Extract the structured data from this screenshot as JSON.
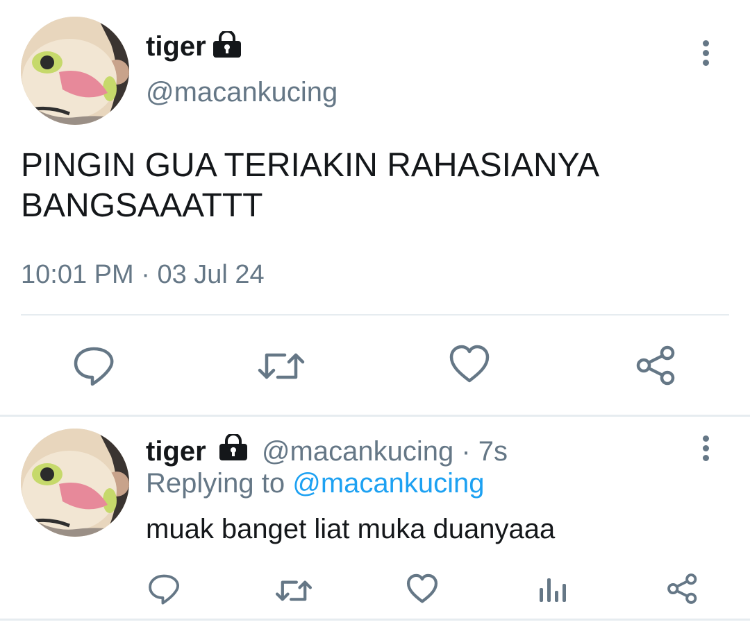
{
  "main_tweet": {
    "display_name": "tiger",
    "handle": "@macankucing",
    "text_line1": "PINGIN GUA TERIAKIN RAHASIANYA",
    "text_line2": "BANGSAAATTT",
    "time": "10:01 PM",
    "separator": "·",
    "date": "03 Jul 24",
    "avatar_icon": "tiger-plush-avatar",
    "locked_icon": "lock-icon",
    "actions": [
      "reply-icon",
      "retweet-icon",
      "like-icon",
      "share-icon"
    ]
  },
  "reply_tweet": {
    "display_name": "tiger",
    "handle": "@macankucing",
    "age": "· 7s",
    "replying_prefix": "Replying to",
    "replying_handle": "@macankucing",
    "text": "muak banget liat muka duanyaaa",
    "avatar_icon": "tiger-plush-avatar",
    "locked_icon": "lock-icon",
    "actions": [
      "reply-icon",
      "retweet-icon",
      "like-icon",
      "analytics-icon",
      "share-icon"
    ]
  },
  "colors": {
    "text": "#14171a",
    "muted": "#657786",
    "link": "#1da1f2",
    "divider": "#e6ecf0"
  }
}
